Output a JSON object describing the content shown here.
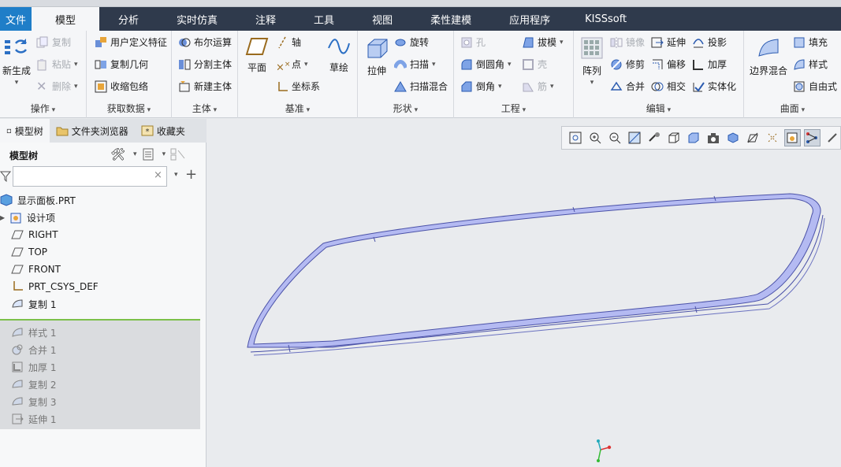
{
  "tabs": [
    {
      "label": "文件"
    },
    {
      "label": "模型"
    },
    {
      "label": "分析"
    },
    {
      "label": "实时仿真"
    },
    {
      "label": "注释"
    },
    {
      "label": "工具"
    },
    {
      "label": "视图"
    },
    {
      "label": "柔性建模"
    },
    {
      "label": "应用程序"
    },
    {
      "label": "KISSsoft"
    }
  ],
  "ribbon": {
    "operations": {
      "label": "操作",
      "regen": "新生成",
      "copy": "复制",
      "paste": "粘贴",
      "delete": "删除"
    },
    "getdata": {
      "label": "获取数据",
      "udf": "用户定义特征",
      "copygeom": "复制几何",
      "shrinkwrap": "收缩包络"
    },
    "body": {
      "label": "主体",
      "boolean": "布尔运算",
      "split": "分割主体",
      "newbody": "新建主体"
    },
    "datum": {
      "label": "基准",
      "plane": "平面",
      "axis": "轴",
      "point": "点",
      "csys": "坐标系",
      "sketch": "草绘"
    },
    "shapes": {
      "label": "形状",
      "extrude": "拉伸",
      "revolve": "旋转",
      "sweep": "扫描",
      "sweepblend": "扫描混合"
    },
    "engineering": {
      "label": "工程",
      "hole": "孔",
      "round": "倒圆角",
      "chamfer": "倒角",
      "draft": "拔模",
      "shell": "壳",
      "rib": "筋"
    },
    "editing": {
      "label": "编辑",
      "pattern": "阵列",
      "mirror": "镜像",
      "trim": "修剪",
      "merge": "合并",
      "extend": "延伸",
      "offset": "偏移",
      "intersect": "相交",
      "project": "投影",
      "thicken": "加厚",
      "solidify": "实体化"
    },
    "surfaces": {
      "label": "曲面",
      "boundary": "边界混合",
      "fill": "填充",
      "style": "样式",
      "freestyle": "自由式"
    }
  },
  "leftpanel": {
    "tabs": [
      {
        "label": "模型树"
      },
      {
        "label": "文件夹浏览器"
      },
      {
        "label": "收藏夹"
      }
    ],
    "title": "模型树",
    "search_value": "",
    "tree": [
      {
        "label": "显示面板.PRT"
      },
      {
        "label": "设计项"
      },
      {
        "label": "RIGHT"
      },
      {
        "label": "TOP"
      },
      {
        "label": "FRONT"
      },
      {
        "label": "PRT_CSYS_DEF"
      },
      {
        "label": "复制 1"
      }
    ],
    "suppressed": [
      {
        "label": "样式 1"
      },
      {
        "label": "合并 1"
      },
      {
        "label": "加厚 1"
      },
      {
        "label": "复制 2"
      },
      {
        "label": "复制 3"
      },
      {
        "label": "延伸 1"
      }
    ]
  },
  "colors": {
    "tabbar": "#2f3a4c",
    "file_tab": "#1f7ec8",
    "model_fill": "#aab0ee",
    "model_edge": "#4b52a8",
    "tree_accent": "#7cc04a"
  }
}
